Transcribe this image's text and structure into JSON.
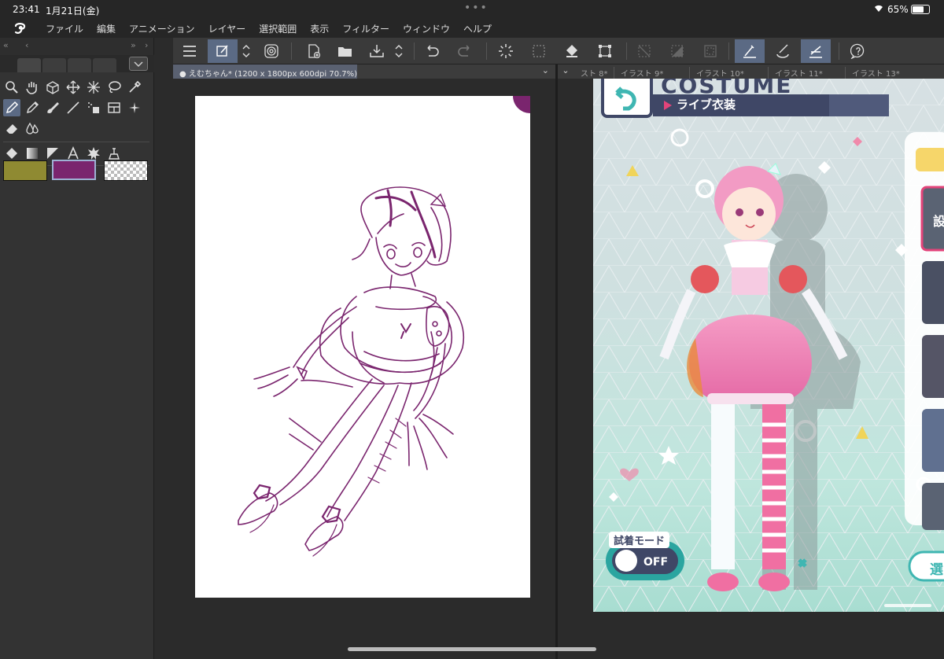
{
  "status": {
    "time": "23:41",
    "date": "1月21日(金)",
    "battery": "65%"
  },
  "menu": [
    "ファイル",
    "編集",
    "アニメーション",
    "レイヤー",
    "選択範囲",
    "表示",
    "フィルター",
    "ウィンドウ",
    "ヘルプ"
  ],
  "colors": {
    "main": "#8f8a32",
    "sub": "#7a256e",
    "accent": "#5b6a84"
  },
  "document": {
    "tab": "えむちゃん* (1200 x 1800px 600dpi 70.7%)"
  },
  "other_tabs": [
    "スト 8*",
    "イラスト 9*",
    "イラスト 10*",
    "イラスト 11*",
    "イラスト 13*"
  ],
  "game": {
    "title": "COSTUME",
    "subtitle": "ライブ衣装",
    "trial_label": "試着モード",
    "toggle_state": "OFF",
    "side_char": "設",
    "select_label": "選"
  }
}
